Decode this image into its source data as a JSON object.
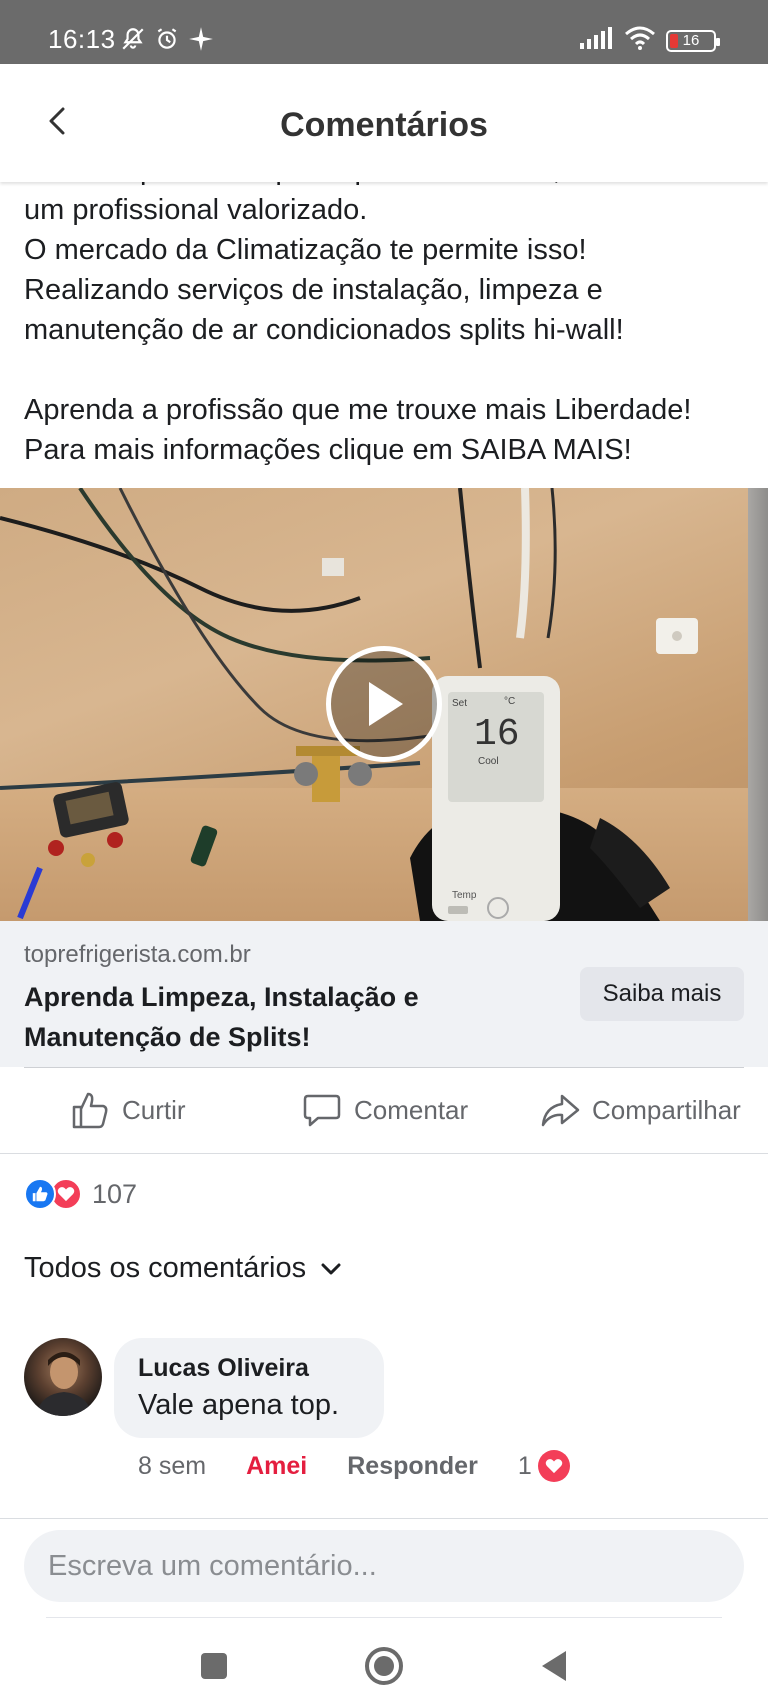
{
  "status_bar": {
    "time": "16:13",
    "battery": "16",
    "icons_left": [
      "mute-icon",
      "alarm-icon",
      "sparkle-icon"
    ],
    "icons_right": [
      "signal-icon",
      "wifi-icon",
      "battery-icon"
    ]
  },
  "header": {
    "title": "Comentários",
    "back_icon": "chevron-left-icon"
  },
  "post": {
    "lines": [
      "Em uma profissão que te permite crescer, se tornar",
      "um profissional valorizado.",
      "O mercado da Climatização te permite isso!",
      "Realizando serviços de instalação, limpeza e",
      "manutenção de ar condicionados splits hi-wall!",
      "Aprenda a profissão que me trouxe mais Liberdade!",
      "Para mais informações clique em SAIBA MAIS!"
    ]
  },
  "video": {
    "remote_temp": "16",
    "remote_unit": "°C",
    "remote_set": "Set",
    "remote_mode": "Cool",
    "remote_temp_label": "Temp"
  },
  "link_preview": {
    "domain": "toprefrigerista.com.br",
    "headline": "Aprenda Limpeza, Instalação e Manutenção de Splits!",
    "cta": "Saiba mais"
  },
  "actions": {
    "like": "Curtir",
    "comment": "Comentar",
    "share": "Compartilhar"
  },
  "reactions": {
    "count": "107",
    "types": [
      "like",
      "love"
    ],
    "like_color": "#1877f2",
    "love_color": "#f33e58"
  },
  "comments_filter": "Todos os comentários",
  "comments": [
    {
      "author": "Lucas Oliveira",
      "text": "Vale apena top.",
      "time": "8 sem",
      "reaction_label": "Amei",
      "reply_label": "Responder",
      "reaction_count": "1"
    }
  ],
  "composer": {
    "placeholder": "Escreva um comentário..."
  },
  "colors": {
    "status_bar": "#6b6b6b",
    "accent": "#1877f2",
    "love": "#e41e3f",
    "muted_text": "#65676b",
    "surface": "#f0f2f5"
  }
}
